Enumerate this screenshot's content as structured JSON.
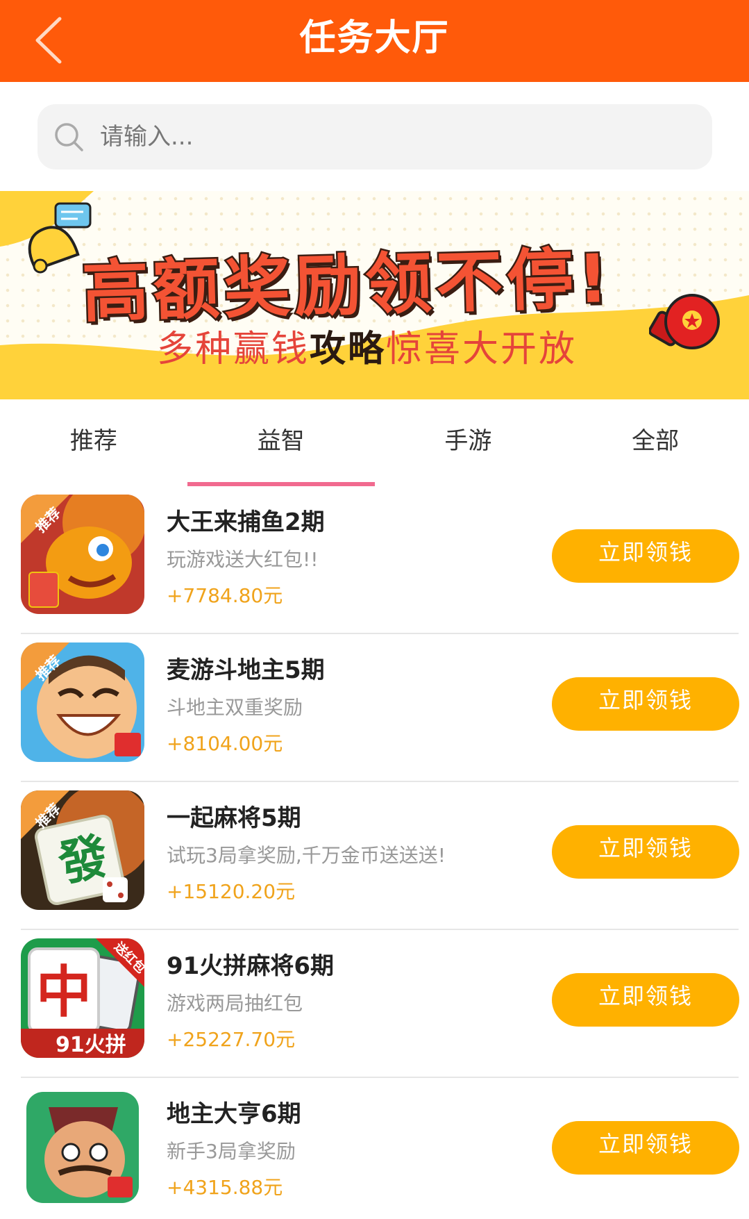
{
  "header": {
    "title": "任务大厅",
    "back_icon": "chevron-left-icon"
  },
  "search": {
    "placeholder": "请输入...",
    "value": "",
    "icon": "search-icon"
  },
  "banner": {
    "headline": "高额奖励领不停!",
    "subtitle_part1": "多种赢钱",
    "subtitle_strong": "攻略",
    "subtitle_part2": "惊喜大开放",
    "icons": [
      "bell-icon",
      "boxing-glove-icon"
    ]
  },
  "tabs": [
    {
      "label": "推荐",
      "active": false
    },
    {
      "label": "益智",
      "active": true
    },
    {
      "label": "手游",
      "active": false
    },
    {
      "label": "全部",
      "active": false
    }
  ],
  "tasks": [
    {
      "name": "大王来捕鱼2期",
      "desc": "玩游戏送大红包!!",
      "reward": "+7784.80元",
      "button": "立即领钱",
      "badge": "推荐",
      "icon": "fish-game-icon"
    },
    {
      "name": "麦游斗地主5期",
      "desc": "斗地主双重奖励",
      "reward": "+8104.00元",
      "button": "立即领钱",
      "badge": "推荐",
      "icon": "doudizhu-game-icon"
    },
    {
      "name": "一起麻将5期",
      "desc": "试玩3局拿奖励,千万金币送送送!",
      "reward": "+15120.20元",
      "button": "立即领钱",
      "badge": "推荐",
      "icon": "mahjong-game-icon"
    },
    {
      "name": "91火拼麻将6期",
      "desc": "游戏两局抽红包",
      "reward": "+25227.70元",
      "button": "立即领钱",
      "badge": "送红包",
      "icon": "huopin-mahjong-icon"
    },
    {
      "name": "地主大亨6期",
      "desc": "新手3局拿奖励",
      "reward": "+4315.88元",
      "button": "立即领钱",
      "badge": "",
      "icon": "landlord-tycoon-icon"
    }
  ],
  "colors": {
    "header": "#ff5a0a",
    "button": "#ffb100",
    "reward": "#f0a31b",
    "tab_indicator": "#f16a8f"
  }
}
